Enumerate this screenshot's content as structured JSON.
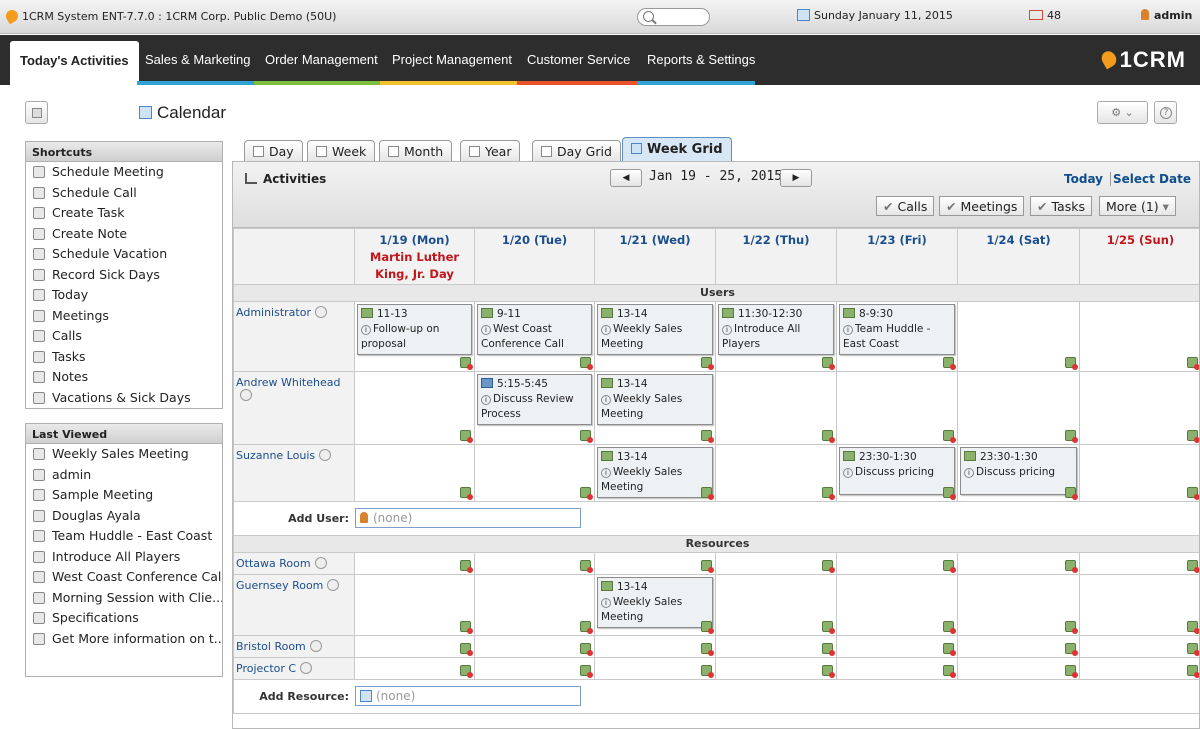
{
  "window": {
    "title": "1CRM System ENT-7.7.0 : 1CRM Corp. Public Demo (50U)",
    "date": "Sunday January 11, 2015",
    "mail_count": "48",
    "user": "admin"
  },
  "nav": {
    "tabs": [
      "Today's Activities",
      "Sales & Marketing",
      "Order Management",
      "Project Management",
      "Customer Service",
      "Reports & Settings"
    ],
    "brand": "1CRM",
    "underline_colors": [
      "#2fa3d6",
      "#7bbf3c",
      "#f1c12e",
      "#e8532c",
      "#2fa3d6",
      "#b45bb3"
    ]
  },
  "page": {
    "title": "Calendar"
  },
  "shortcuts": {
    "header": "Shortcuts",
    "items": [
      "Schedule Meeting",
      "Schedule Call",
      "Create Task",
      "Create Note",
      "Schedule Vacation",
      "Record Sick Days",
      "Today",
      "Meetings",
      "Calls",
      "Tasks",
      "Notes",
      "Vacations & Sick Days"
    ]
  },
  "last_viewed": {
    "header": "Last Viewed",
    "items": [
      "Weekly Sales Meeting",
      "admin",
      "Sample Meeting",
      "Douglas Ayala",
      "Team Huddle - East Coast",
      "Introduce All Players",
      "West Coast Conference Call",
      "Morning Session with Clie...",
      "Specifications",
      "Get More information on t..."
    ]
  },
  "view_tabs": [
    "Day",
    "Week",
    "Month",
    "Year",
    "Day Grid",
    "Week Grid"
  ],
  "calendar": {
    "activities_label": "Activities",
    "range": "Jan 19 - 25, 2015",
    "today": "Today",
    "select_date": "Select Date",
    "filters": [
      "Calls",
      "Meetings",
      "Tasks",
      "More (1)"
    ],
    "days": [
      "1/19 (Mon)",
      "1/20 (Tue)",
      "1/21 (Wed)",
      "1/22 (Thu)",
      "1/23 (Fri)",
      "1/24 (Sat)",
      "1/25 (Sun)"
    ],
    "holiday": "Martin Luther King, Jr. Day",
    "users_label": "Users",
    "resources_label": "Resources",
    "add_user_label": "Add User:",
    "add_resource_label": "Add Resource:",
    "none": "(none)",
    "users": [
      {
        "name": "Administrator",
        "events": [
          {
            "time": "11-13",
            "title": "Follow-up on proposal",
            "kind": "meeting"
          },
          {
            "time": "9-11",
            "title": "West Coast Conference Call",
            "kind": "meeting"
          },
          {
            "time": "13-14",
            "title": "Weekly Sales Meeting",
            "kind": "meeting"
          },
          {
            "time": "11:30-12:30",
            "title": "Introduce All Players",
            "kind": "meeting"
          },
          {
            "time": "8-9:30",
            "title": "Team Huddle - East Coast",
            "kind": "meeting"
          },
          null,
          null
        ]
      },
      {
        "name": "Andrew Whitehead",
        "events": [
          null,
          {
            "time": "5:15-5:45",
            "title": "Discuss Review Process",
            "kind": "call"
          },
          {
            "time": "13-14",
            "title": "Weekly Sales Meeting",
            "kind": "meeting"
          },
          null,
          null,
          null,
          null
        ]
      },
      {
        "name": "Suzanne Louis",
        "events": [
          null,
          null,
          {
            "time": "13-14",
            "title": "Weekly Sales Meeting",
            "kind": "meeting"
          },
          null,
          {
            "time": "23:30-1:30",
            "title": "Discuss pricing",
            "kind": "meeting"
          },
          {
            "time": "23:30-1:30",
            "title": "Discuss pricing",
            "kind": "meeting"
          },
          null
        ]
      }
    ],
    "resources": [
      {
        "name": "Ottawa Room",
        "events": [
          null,
          null,
          null,
          null,
          null,
          null,
          null
        ]
      },
      {
        "name": "Guernsey Room",
        "events": [
          null,
          null,
          {
            "time": "13-14",
            "title": "Weekly Sales Meeting",
            "kind": "meeting"
          },
          null,
          null,
          null,
          null
        ]
      },
      {
        "name": "Bristol Room",
        "events": [
          null,
          null,
          null,
          null,
          null,
          null,
          null
        ]
      },
      {
        "name": "Projector C",
        "events": [
          null,
          null,
          null,
          null,
          null,
          null,
          null
        ]
      }
    ]
  }
}
